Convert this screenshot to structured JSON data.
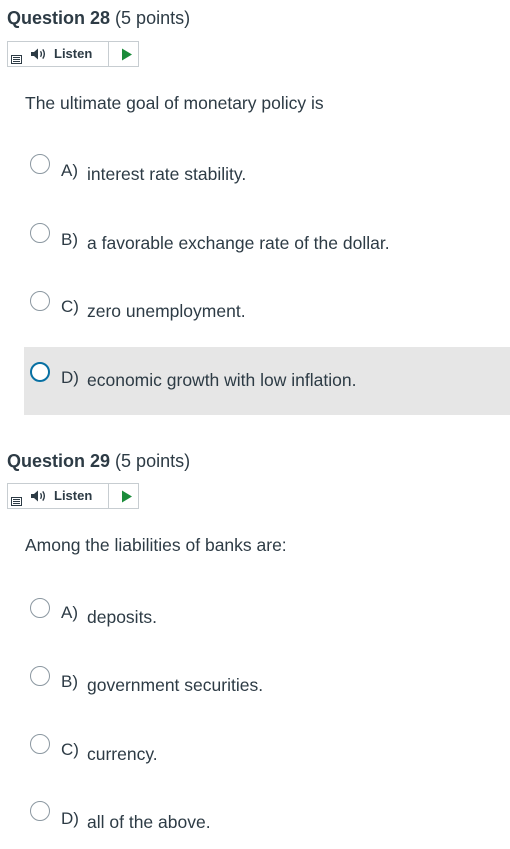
{
  "questions": [
    {
      "title": "Question 28",
      "points": "(5 points)",
      "listen_label": "Listen",
      "stem": "The ultimate goal of monetary policy is",
      "choices": [
        {
          "letter": "A)",
          "text": "interest rate stability."
        },
        {
          "letter": "B)",
          "text": "a favorable exchange rate of the dollar."
        },
        {
          "letter": "C)",
          "text": "zero unemployment."
        },
        {
          "letter": "D)",
          "text": "economic growth with low inflation."
        }
      ]
    },
    {
      "title": "Question 29",
      "points": "(5 points)",
      "listen_label": "Listen",
      "stem": "Among the liabilities of banks are:",
      "choices": [
        {
          "letter": "A)",
          "text": "deposits."
        },
        {
          "letter": "B)",
          "text": "government securities."
        },
        {
          "letter": "C)",
          "text": "currency."
        },
        {
          "letter": "D)",
          "text": "all of the above."
        }
      ]
    }
  ],
  "colors": {
    "accent": "#0770a3",
    "play": "#1b8c3a",
    "highlight": "#e6e6e6"
  },
  "icons": [
    "menu-icon",
    "speaker-icon",
    "play-icon",
    "radio-icon"
  ]
}
